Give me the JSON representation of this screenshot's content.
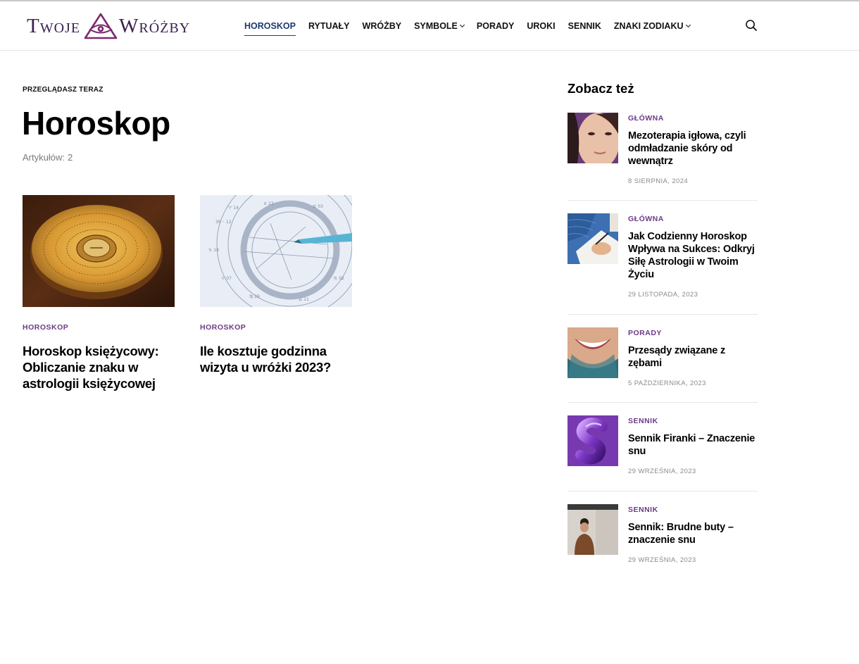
{
  "header": {
    "logo": {
      "word_left": "Twoje",
      "word_right": "Wróżby"
    },
    "nav": [
      {
        "label": "Horoskop",
        "active": true,
        "dropdown": false
      },
      {
        "label": "Rytuały",
        "active": false,
        "dropdown": false
      },
      {
        "label": "Wróżby",
        "active": false,
        "dropdown": false
      },
      {
        "label": "Symbole",
        "active": false,
        "dropdown": true
      },
      {
        "label": "Porady",
        "active": false,
        "dropdown": false
      },
      {
        "label": "Uroki",
        "active": false,
        "dropdown": false
      },
      {
        "label": "Sennik",
        "active": false,
        "dropdown": false
      },
      {
        "label": "Znaki zodiaku",
        "active": false,
        "dropdown": true
      }
    ],
    "search_icon": "search-icon"
  },
  "main": {
    "browsing_label": "Przeglądasz teraz",
    "title": "Horoskop",
    "count_label": "Artykułów:",
    "count_value": "2",
    "articles": [
      {
        "category": "Horoskop",
        "title": "Horoskop księżycowy: Obliczanie znaku w astrologii księżycowej",
        "image": "feng-shui-compass"
      },
      {
        "category": "Horoskop",
        "title": "Ile kosztuje godzinna wizyta u wróżki 2023?",
        "image": "astrology-chart"
      }
    ]
  },
  "aside": {
    "title": "Zobacz też",
    "items": [
      {
        "category": "Główna",
        "title": "Mezoterapia igłowa, czyli odmładzanie skóry od wewnątrz",
        "date": "8 sierpnia, 2024",
        "image": "woman-face"
      },
      {
        "category": "Główna",
        "title": "Jak Codzienny Horoskop Wpływa na Sukces: Odkryj Siłę Astrologii w Twoim Życiu",
        "date": "29 listopada, 2023",
        "image": "writing-hand"
      },
      {
        "category": "Porady",
        "title": "Przesądy związane z zębami",
        "date": "5 października, 2023",
        "image": "smile"
      },
      {
        "category": "Sennik",
        "title": "Sennik Firanki – Znaczenie snu",
        "date": "29 września, 2023",
        "image": "letter-s"
      },
      {
        "category": "Sennik",
        "title": "Sennik: Brudne buty – znaczenie snu",
        "date": "29 września, 2023",
        "image": "person-portrait"
      }
    ]
  },
  "colors": {
    "accent": "#6b3a87",
    "nav_active": "#1c3a6e",
    "logo": "#3b2050"
  }
}
